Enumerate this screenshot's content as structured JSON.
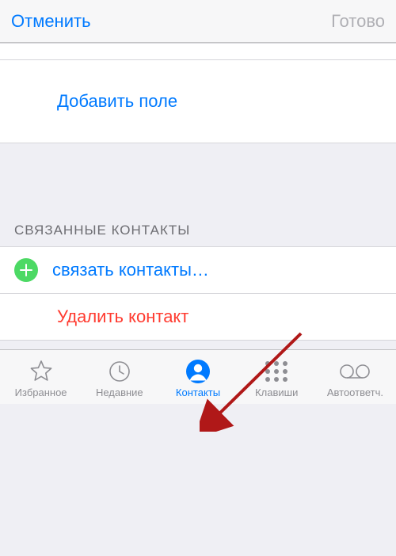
{
  "nav": {
    "cancel": "Отменить",
    "done": "Готово"
  },
  "addField": "Добавить поле",
  "linkedSectionHeader": "СВЯЗАННЫЕ КОНТАКТЫ",
  "linkContacts": "связать контакты…",
  "deleteContact": "Удалить контакт",
  "tabs": {
    "favorites": "Избранное",
    "recents": "Недавние",
    "contacts": "Контакты",
    "keypad": "Клавиши",
    "voicemail": "Автоответч."
  }
}
